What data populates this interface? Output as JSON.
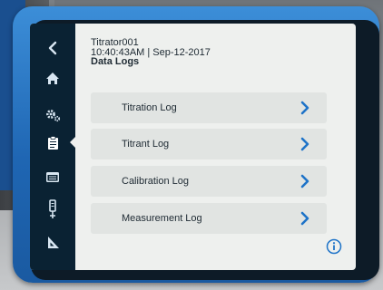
{
  "device": {
    "name": "Titrator001",
    "datetime": "10:40:43AM | Sep-12-2017",
    "screen_title": "Data Logs"
  },
  "sidebar": {
    "items": [
      {
        "icon": "back-chevron-icon",
        "active": false
      },
      {
        "icon": "home-icon",
        "active": false
      },
      {
        "icon": "settings-gears-icon",
        "active": false
      },
      {
        "icon": "clipboard-icon",
        "active": true
      },
      {
        "icon": "calendar-icon",
        "active": false
      },
      {
        "icon": "electrode-probe-icon",
        "active": false
      },
      {
        "icon": "triangle-ruler-icon",
        "active": false
      }
    ]
  },
  "menu": {
    "items": [
      {
        "label": "Titration Log"
      },
      {
        "label": "Titrant Log"
      },
      {
        "label": "Calibration Log"
      },
      {
        "label": "Measurement Log"
      }
    ]
  },
  "colors": {
    "sidebar_bg": "#0a2233",
    "icon": "#d8e6f2",
    "active_icon": "#ffffff",
    "accent": "#1e73c8",
    "screen_bg": "#eef0ee",
    "item_bg": "#e1e4e2",
    "bezel": "#2577c6"
  }
}
